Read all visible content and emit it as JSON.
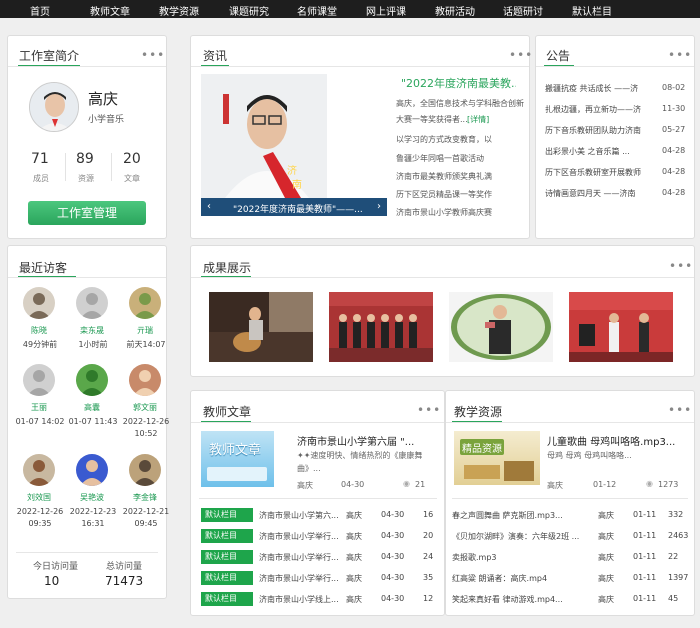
{
  "nav": [
    "首页",
    "教师文章",
    "教学资源",
    "课题研究",
    "名师课堂",
    "网上评课",
    "教研活动",
    "话题研讨",
    "默认栏目"
  ],
  "profile": {
    "title": "工作室简介",
    "name": "高庆",
    "subject": "小学音乐",
    "stats": [
      {
        "num": "71",
        "label": "成员"
      },
      {
        "num": "89",
        "label": "资源"
      },
      {
        "num": "20",
        "label": "文章"
      }
    ],
    "button": "工作室管理",
    "more": "•••"
  },
  "visitors": {
    "title": "最近访客",
    "list": [
      {
        "name": "陈晓",
        "time": "49分钟前"
      },
      {
        "name": "栾东晟",
        "time": "1小时前"
      },
      {
        "name": "亓瑞",
        "time": "前天14:07"
      },
      {
        "name": "王丽",
        "time": "01-07 14:02"
      },
      {
        "name": "高囊",
        "time": "01-07 11:43"
      },
      {
        "name": "郭文丽",
        "time": "2022-12-26 10:52"
      },
      {
        "name": "刘效国",
        "time": "2022-12-26 09:35"
      },
      {
        "name": "吴艳波",
        "time": "2022-12-23 16:31"
      },
      {
        "name": "李金锋",
        "time": "2022-12-21 09:45"
      }
    ],
    "today_label": "今日访问量",
    "total_label": "总访问量",
    "today": "10",
    "total": "71473"
  },
  "news": {
    "title": "资讯",
    "more": "•••",
    "headline": "\"2022年度济南最美教...",
    "lines": [
      "高庆，全国信息技术与学科融合创新",
      "大赛一等奖获得者...",
      "以学习的方式改变教育，以",
      "鲁疆少年同唱一首歌活动",
      "济南市最美教师颁奖典礼满",
      "历下区党员精品课一等奖作",
      "济南市景山小学教师高庆赛"
    ],
    "detail": "[详情]",
    "caption": "\"2022年度济南最美教师\"——...",
    "photo_banner": "济南最美"
  },
  "notice": {
    "title": "公告",
    "more": "•••",
    "items": [
      {
        "text": "搬疆抗疫 共话成长 ——济",
        "date": "08-02"
      },
      {
        "text": "扎根边疆，再立新功——济",
        "date": "11-30"
      },
      {
        "text": "历下音乐教研团队助力济南",
        "date": "05-27"
      },
      {
        "text": "出彩景小美 之音乐篇 ...",
        "date": "04-28"
      },
      {
        "text": "历下区音乐教研室开展教师",
        "date": "04-28"
      },
      {
        "text": "诗情画意四月天 ——济南",
        "date": "04-28"
      }
    ]
  },
  "achievements": {
    "title": "成果展示",
    "more": "•••"
  },
  "articles": {
    "title": "教师文章",
    "more": "•••",
    "feature": {
      "title": "济南市景山小学第六届 \"...",
      "desc1": "✦✦速度明快、情绪热烈的《康康舞",
      "desc2": "曲》...",
      "author": "高庆",
      "date": "04-30",
      "count": "21",
      "thumb": "教师文章"
    },
    "rows": [
      {
        "tag": "默认栏目",
        "title": "济南市景山小学第六...",
        "author": "高庆",
        "date": "04-30",
        "count": "16"
      },
      {
        "tag": "默认栏目",
        "title": "济南市景山小学举行...",
        "author": "高庆",
        "date": "04-30",
        "count": "20"
      },
      {
        "tag": "默认栏目",
        "title": "济南市景山小学举行...",
        "author": "高庆",
        "date": "04-30",
        "count": "24"
      },
      {
        "tag": "默认栏目",
        "title": "济南市景山小学举行...",
        "author": "高庆",
        "date": "04-30",
        "count": "35"
      },
      {
        "tag": "默认栏目",
        "title": "济南市景山小学线上...",
        "author": "高庆",
        "date": "04-30",
        "count": "12"
      }
    ]
  },
  "resources": {
    "title": "教学资源",
    "more": "•••",
    "feature": {
      "title": "儿童歌曲 母鸡叫咯咯.mp3...",
      "desc": "母鸡 母鸡 母鸡叫咯咯...",
      "author": "高庆",
      "date": "01-12",
      "count": "1273",
      "thumb": "精品资源"
    },
    "rows": [
      {
        "title": "春之声圆舞曲 萨克斯团.mp3...",
        "author": "高庆",
        "date": "01-11",
        "count": "332"
      },
      {
        "title": "《贝加尔湖畔》演奏：六年级2班 ...",
        "author": "高庆",
        "date": "01-11",
        "count": "2463"
      },
      {
        "title": "卖报歌.mp3",
        "author": "高庆",
        "date": "01-11",
        "count": "22"
      },
      {
        "title": "红高粱 朗诵者：高庆.mp4",
        "author": "高庆",
        "date": "01-11",
        "count": "1397"
      },
      {
        "title": "笑起来真好看 律动游戏.mp4...",
        "author": "高庆",
        "date": "01-11",
        "count": "45"
      }
    ]
  }
}
